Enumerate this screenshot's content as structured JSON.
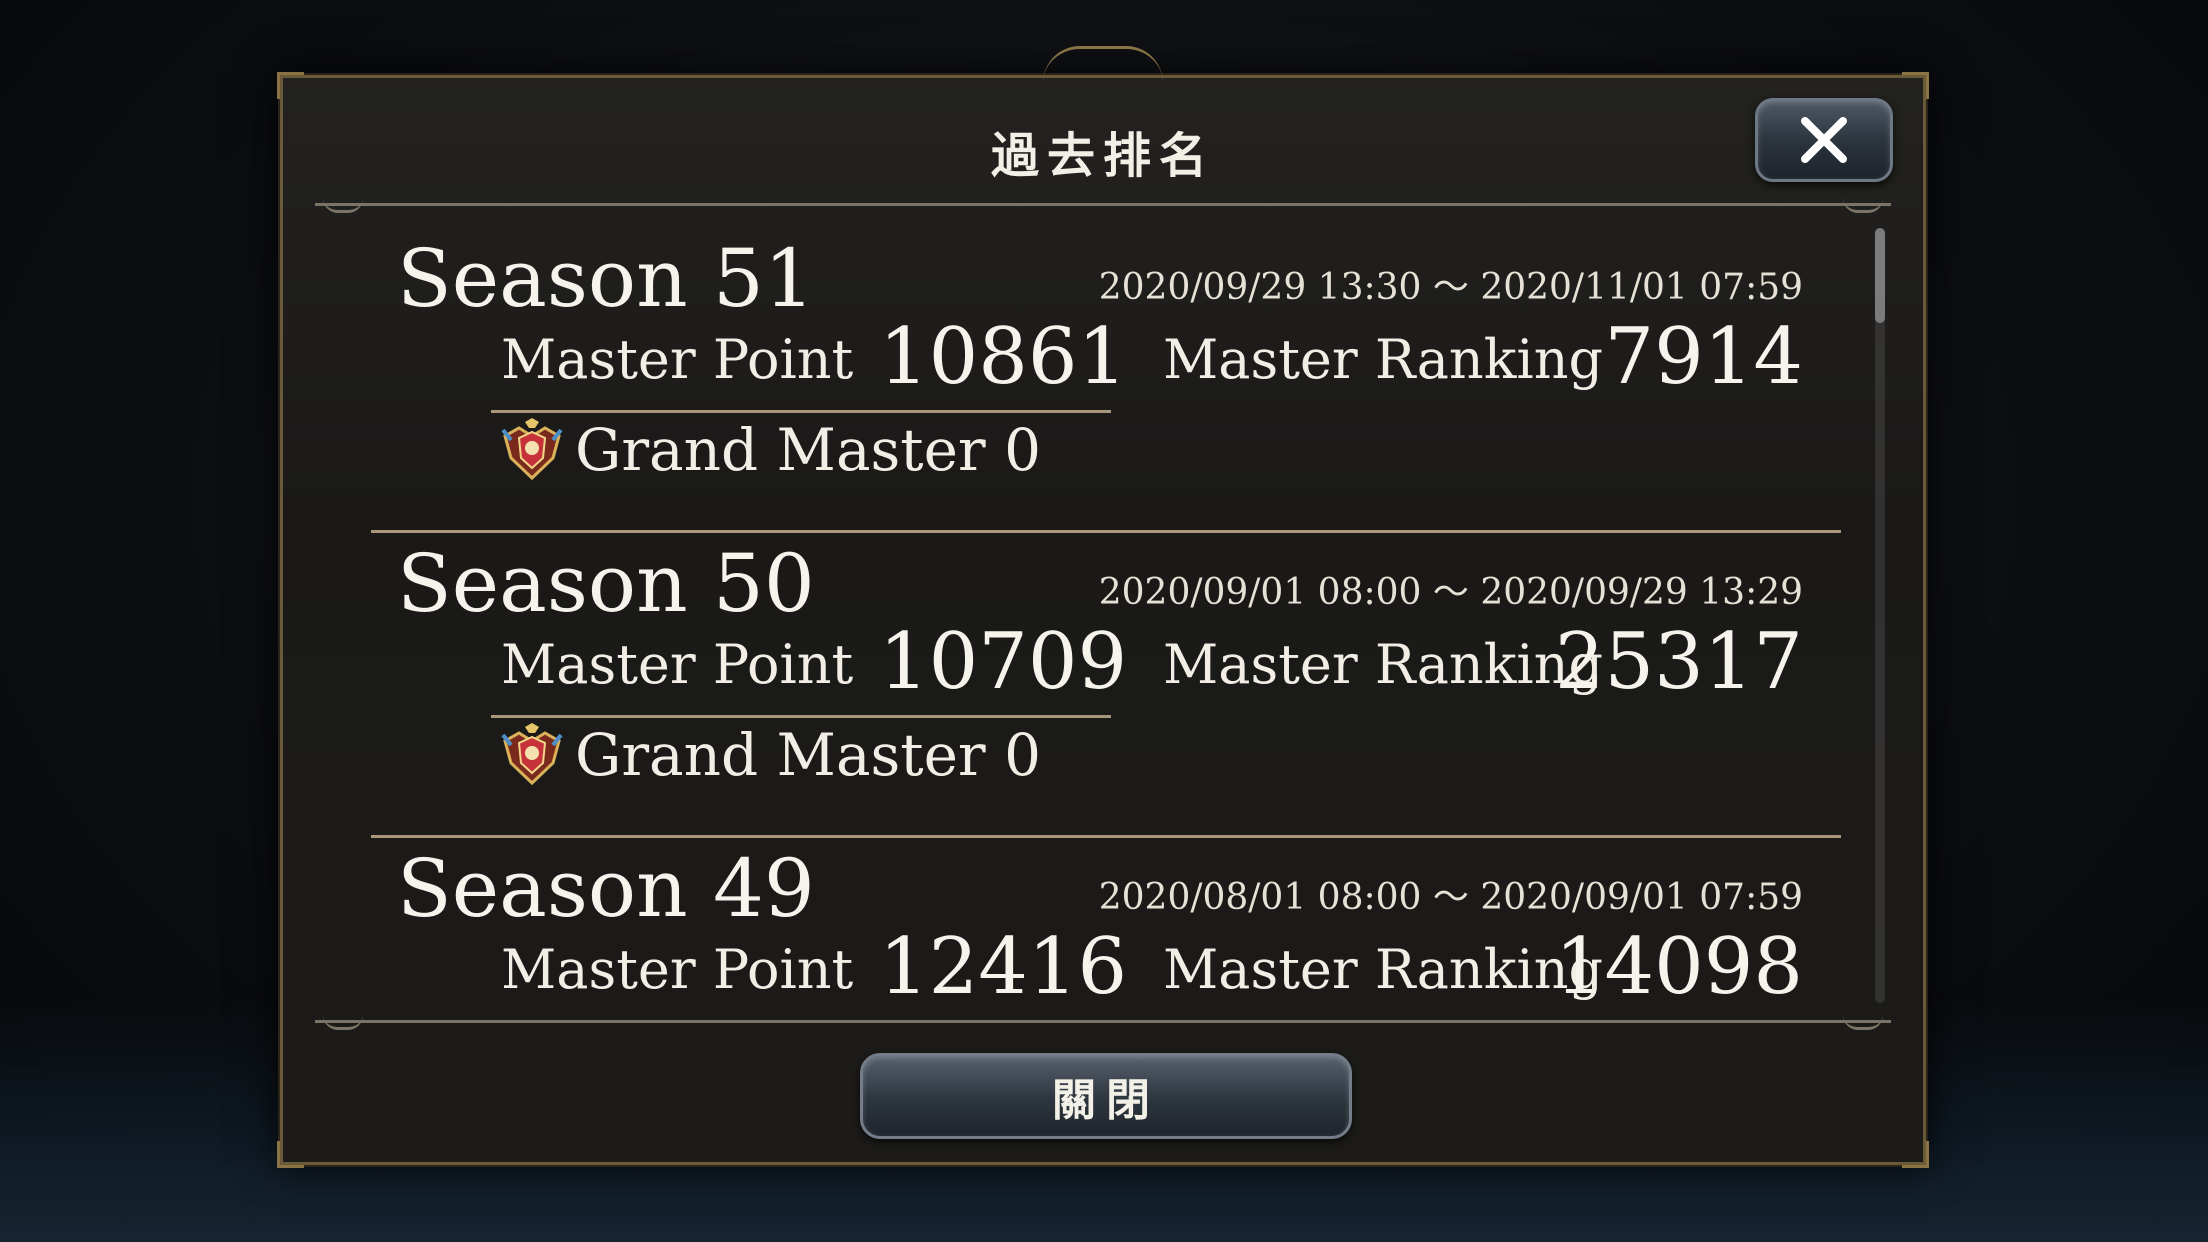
{
  "dialog": {
    "title": "過去排名",
    "close_button_label": "關閉",
    "close_icon": "close-x-icon"
  },
  "seasons": [
    {
      "name": "Season 51",
      "period": "2020/09/29 13:30 ～ 2020/11/01 07:59",
      "master_point_label": "Master Point",
      "master_point": "10861",
      "master_ranking_label": "Master Ranking",
      "master_ranking": "7914",
      "rank_label": "Grand Master 0",
      "rank_icon": "grand-master-badge-icon"
    },
    {
      "name": "Season 50",
      "period": "2020/09/01 08:00 ～ 2020/09/29 13:29",
      "master_point_label": "Master Point",
      "master_point": "10709",
      "master_ranking_label": "Master Ranking",
      "master_ranking": "25317",
      "rank_label": "Grand Master 0",
      "rank_icon": "grand-master-badge-icon"
    },
    {
      "name": "Season 49",
      "period": "2020/08/01 08:00 ～ 2020/09/01 07:59",
      "master_point_label": "Master Point",
      "master_point": "12416",
      "master_ranking_label": "Master Ranking",
      "master_ranking": "14098",
      "rank_label": "",
      "rank_icon": "grand-master-badge-icon"
    }
  ],
  "colors": {
    "frame_gold": "#6b5a37",
    "divider": "#a8977a",
    "button_blue": "#2d353e"
  }
}
